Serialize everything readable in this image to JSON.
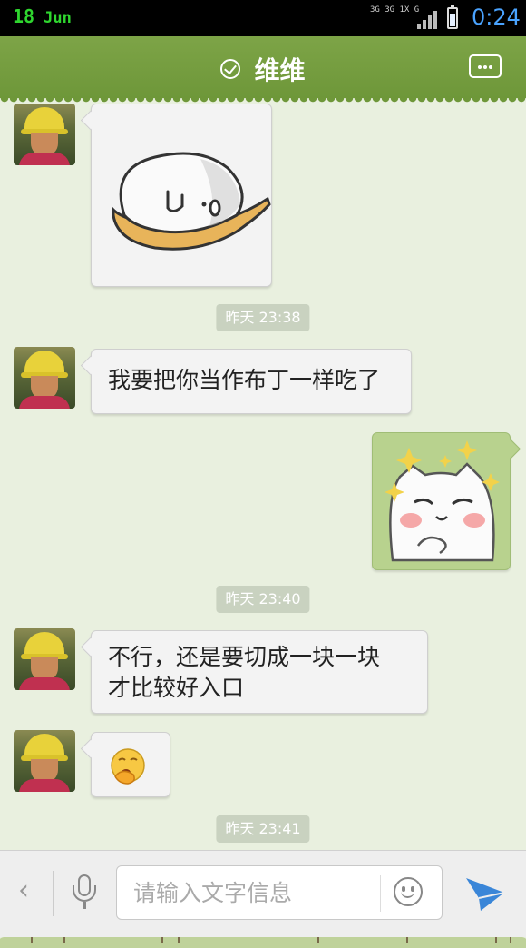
{
  "status_bar": {
    "day": "18",
    "month": "Jun",
    "network": "3G 3G 1X G",
    "time": "0:24",
    "battery_level": 0.7
  },
  "header": {
    "title": "维维",
    "status_icon": "verified-check-icon",
    "menu_icon": "more-icon"
  },
  "messages": [
    {
      "side": "left",
      "kind": "sticker",
      "sticker": "rice-ball-on-spoon"
    },
    {
      "side": "center",
      "kind": "timestamp",
      "text": "昨天 23:38"
    },
    {
      "side": "left",
      "kind": "text",
      "text": "我要把你当作布丁一样吃了"
    },
    {
      "side": "right",
      "kind": "sticker",
      "sticker": "smug-white-cat-sparkles"
    },
    {
      "side": "center",
      "kind": "timestamp",
      "text": "昨天 23:40"
    },
    {
      "side": "left",
      "kind": "text",
      "text": "不行，还是要切成一块一块\n才比较好入口"
    },
    {
      "side": "left",
      "kind": "emoji",
      "emoji": "yawning-face"
    },
    {
      "side": "center",
      "kind": "timestamp",
      "text": "昨天 23:41"
    }
  ],
  "input_bar": {
    "back_icon": "chevron-left-icon",
    "mic_icon": "microphone-icon",
    "placeholder": "请输入文字信息",
    "emoji_icon": "smiley-icon",
    "send_icon": "send-arrow-icon"
  },
  "colors": {
    "header_bg": "#7da447",
    "chat_bg": "#e9f0df",
    "left_bubble": "#f3f3f3",
    "right_bubble": "#b8d28e",
    "send_accent": "#3a86d8",
    "time_accent": "#4aa3ff",
    "date_accent": "#2fd62f"
  }
}
